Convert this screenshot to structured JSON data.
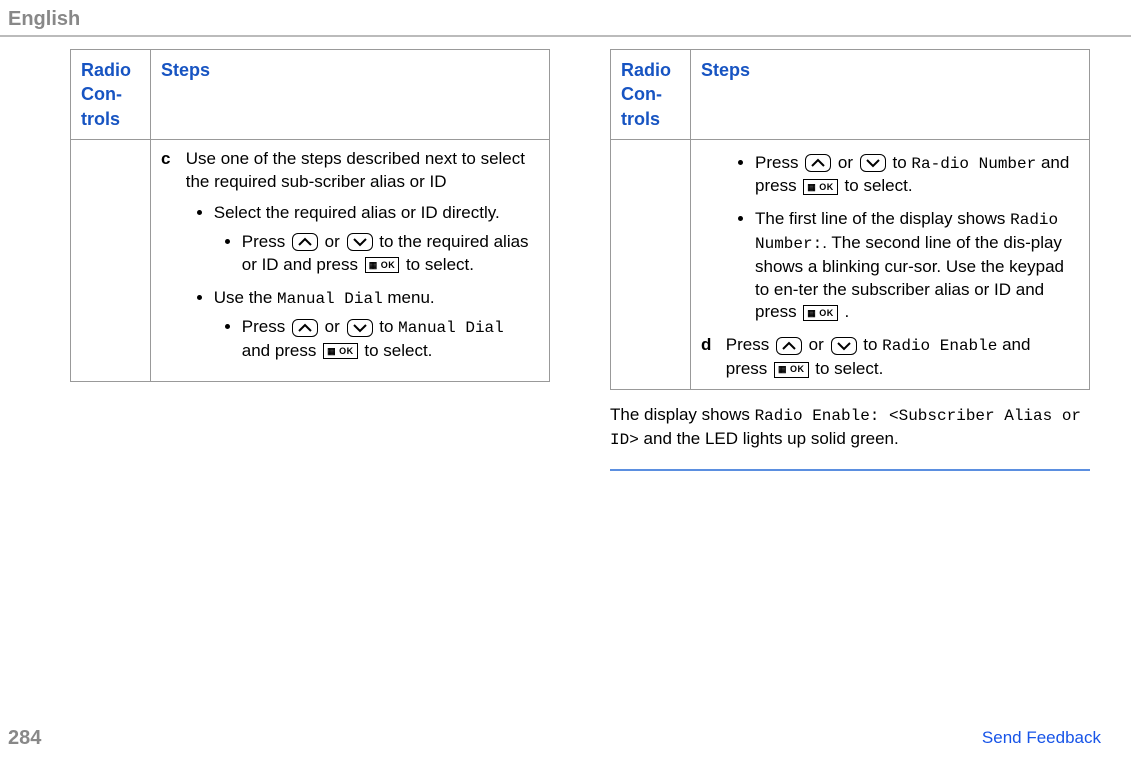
{
  "header": {
    "language": "English"
  },
  "left_table": {
    "headers": {
      "controls": "Radio Con-trols",
      "steps": "Steps"
    },
    "step_c": {
      "letter": "c",
      "intro": "Use one of the steps described next to select the required sub-scriber alias or ID",
      "b1": "Select the required alias or ID directly.",
      "b1_sub_before": "Press ",
      "b1_sub_mid1": " or ",
      "b1_sub_mid2": " to the required alias or ID and press ",
      "b1_sub_after": " to select.",
      "b2_before": "Use the ",
      "b2_mono": "Manual Dial",
      "b2_after": " menu.",
      "b2_sub_before": "Press ",
      "b2_sub_mid1": " or ",
      "b2_sub_mid2": " to ",
      "b2_sub_mono": "Manual Dial",
      "b2_sub_mid3": " and press ",
      "b2_sub_after": " to select."
    }
  },
  "right_table": {
    "headers": {
      "controls": "Radio Con-trols",
      "steps": "Steps"
    },
    "step_cont": {
      "b1_before": "Press ",
      "b1_mid1": " or ",
      "b1_mid2": " to ",
      "b1_mono": "Ra-dio Number",
      "b1_mid3": " and press ",
      "b1_after": " to select.",
      "b2_before": "The first line of the display shows ",
      "b2_mono": "Radio Number:",
      "b2_after": ". The second line of the dis-play shows a blinking cur-sor. Use the keypad to en-ter the subscriber alias or ID and press ",
      "b2_end": " ."
    },
    "step_d": {
      "letter": "d",
      "before": "Press ",
      "mid1": " or ",
      "mid2": " to ",
      "mono1": "Radio Enable",
      "mid3": " and press ",
      "after": " to select."
    }
  },
  "after": {
    "before": "The display shows ",
    "mono": "Radio Enable: <Subscriber Alias or ID>",
    "after": " and the LED lights up solid green."
  },
  "footer": {
    "page": "284",
    "feedback": "Send Feedback"
  },
  "icons": {
    "ok_label": "▦ OK"
  }
}
